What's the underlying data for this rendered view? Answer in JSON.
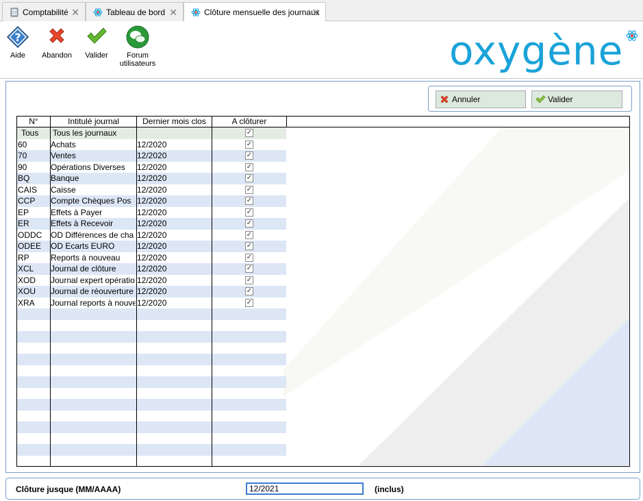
{
  "tabs": [
    {
      "label": "Comptabilité",
      "icon": "calculator-icon"
    },
    {
      "label": "Tableau de bord",
      "icon": "atom-icon"
    },
    {
      "label": "Clôture mensuelle des journaux",
      "icon": "atom-icon",
      "active": true
    }
  ],
  "toolbar": {
    "help_label": "Aide",
    "abort_label": "Abandon",
    "validate_label": "Valider",
    "forum_label_1": "Forum",
    "forum_label_2": "utilisateurs"
  },
  "logo": {
    "text": "oxygène",
    "color": "#1aa3d9"
  },
  "actions": {
    "cancel_label": "Annuler",
    "validate_label": "Valider"
  },
  "table": {
    "headers": [
      "N°",
      "Intitulé journal",
      "Dernier mois clos",
      "A clôturer"
    ],
    "rows": [
      {
        "num": "Tous",
        "label": "Tous les journaux",
        "last": "",
        "checked": true
      },
      {
        "num": "60",
        "label": "Achats",
        "last": "12/2020",
        "checked": true
      },
      {
        "num": "70",
        "label": "Ventes",
        "last": "12/2020",
        "checked": true
      },
      {
        "num": "90",
        "label": "Opérations Diverses",
        "last": "12/2020",
        "checked": true
      },
      {
        "num": "BQ",
        "label": "Banque",
        "last": "12/2020",
        "checked": true
      },
      {
        "num": "CAIS",
        "label": "Caisse",
        "last": "12/2020",
        "checked": true
      },
      {
        "num": "CCP",
        "label": "Compte Chèques Pos",
        "last": "12/2020",
        "checked": true
      },
      {
        "num": "EP",
        "label": "Effets à Payer",
        "last": "12/2020",
        "checked": true
      },
      {
        "num": "ER",
        "label": "Effets à Recevoir",
        "last": "12/2020",
        "checked": true
      },
      {
        "num": "ODDC",
        "label": "OD Différences de cha",
        "last": "12/2020",
        "checked": true
      },
      {
        "num": "ODEE",
        "label": "OD Ecarts EURO",
        "last": "12/2020",
        "checked": true
      },
      {
        "num": "RP",
        "label": "Reports à nouveau",
        "last": "12/2020",
        "checked": true
      },
      {
        "num": "XCL",
        "label": "Journal de clôture",
        "last": "12/2020",
        "checked": true
      },
      {
        "num": "XOD",
        "label": "Journal expert opératio",
        "last": "12/2020",
        "checked": true
      },
      {
        "num": "XOU",
        "label": "Journal de réouverture",
        "last": "12/2020",
        "checked": true
      },
      {
        "num": "XRA",
        "label": "Journal reports à nouve",
        "last": "12/2020",
        "checked": true
      }
    ],
    "empty_rows": 14
  },
  "footer": {
    "label": "Clôture jusque (MM/AAAA)",
    "value": "12/2021",
    "suffix": "(inclus)"
  },
  "colors": {
    "accent": "#1aa3d9",
    "row_alt": "#dce6f5",
    "border": "#7a9cc6"
  }
}
